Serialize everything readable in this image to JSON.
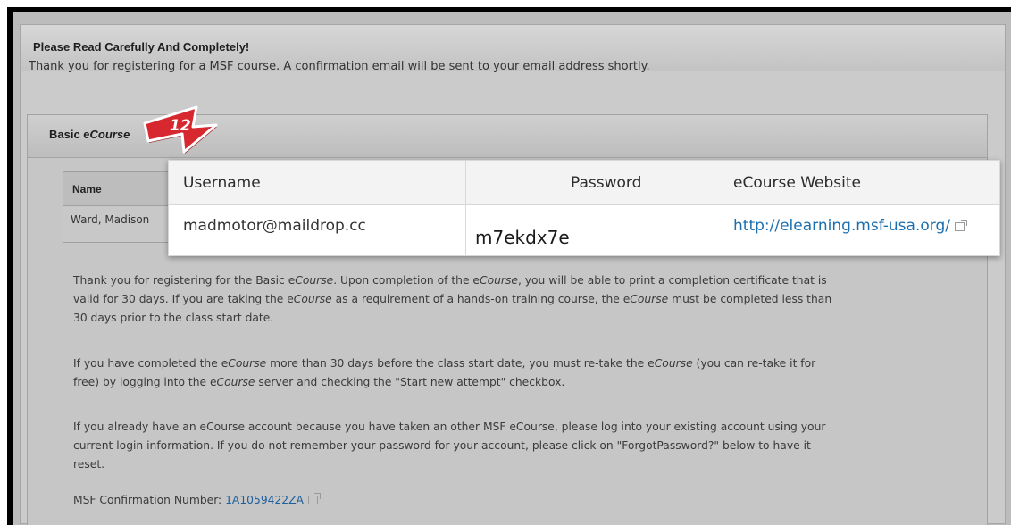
{
  "panel": {
    "title": "Please Read Carefully And Completely!",
    "thanks": "Thank you for registering for a MSF course. A confirmation email will be sent to your email address shortly."
  },
  "course": {
    "title_prefix": "Basic e",
    "title_italic": "Course"
  },
  "callout": {
    "number": "12",
    "color": "#d7282f"
  },
  "name_table": {
    "header": "Name",
    "value": "Ward, Madison"
  },
  "credentials": {
    "columns": [
      "Username",
      "Password",
      "eCourse Website"
    ],
    "username": "madmotor@maildrop.cc",
    "password": "m7ekdx7e",
    "website": "http://elearning.msf-usa.org/"
  },
  "paragraphs": {
    "p1": {
      "a": "Thank you for registering for the Basic e",
      "b": "Course",
      "c": ". Upon completion of the e",
      "d": "Course",
      "e": ", you will be able to print a completion certificate that is",
      "f": "valid for 30 days. If you are taking the e",
      "g": "Course",
      "h": " as a requirement of a hands-on training course, the e",
      "i": "Course",
      "j": " must be completed less than",
      "k": "30 days prior to the class start date."
    },
    "p2": {
      "a": "If you have completed the e",
      "b": "Course",
      "c": " more than 30 days before the class start date, you must re-take the e",
      "d": "Course",
      "e": " (you can re-take it for",
      "f": "free) by logging into the e",
      "g": "Course",
      "h": " server and checking the \"Start new attempt\" checkbox."
    },
    "p3": {
      "line1": "If you already have an eCourse account because you have taken an other MSF eCourse, please log into your existing account using your",
      "line2": "current login information. If you do not remember your password for your account, please click on \"ForgotPassword?\" below to have it",
      "line3": "reset."
    }
  },
  "confirmation": {
    "label": "MSF Confirmation Number: ",
    "number": "1A1059422ZA"
  }
}
